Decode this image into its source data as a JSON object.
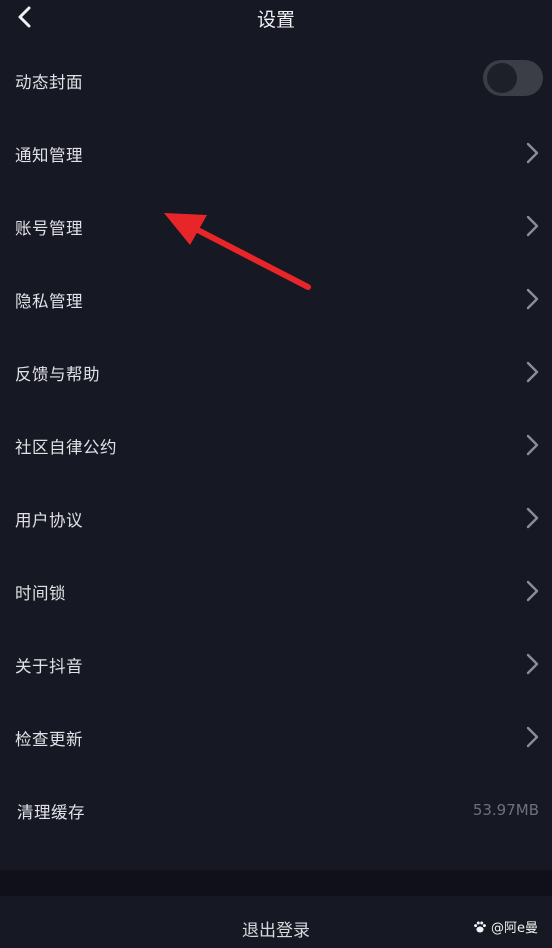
{
  "header": {
    "title": "设置",
    "back_icon": "chevron-left-icon"
  },
  "settings": {
    "dynamic_cover": {
      "label": "动态封面",
      "toggle_on": false
    },
    "notification": {
      "label": "通知管理"
    },
    "account": {
      "label": "账号管理"
    },
    "privacy": {
      "label": "隐私管理"
    },
    "feedback": {
      "label": "反馈与帮助"
    },
    "community": {
      "label": "社区自律公约"
    },
    "user_agreement": {
      "label": "用户协议"
    },
    "time_lock": {
      "label": "时间锁"
    },
    "about": {
      "label": "关于抖音"
    },
    "update": {
      "label": "检查更新"
    },
    "cache": {
      "label": "清理缓存",
      "value": "53.97MB"
    }
  },
  "logout": {
    "label": "退出登录"
  },
  "annotation": {
    "color": "#e8262a",
    "points_to": "账号管理"
  },
  "watermark": {
    "text": "@阿e曼",
    "icon": "paw-icon"
  },
  "colors": {
    "background": "#161823",
    "accent_arrow": "#e8262a"
  }
}
